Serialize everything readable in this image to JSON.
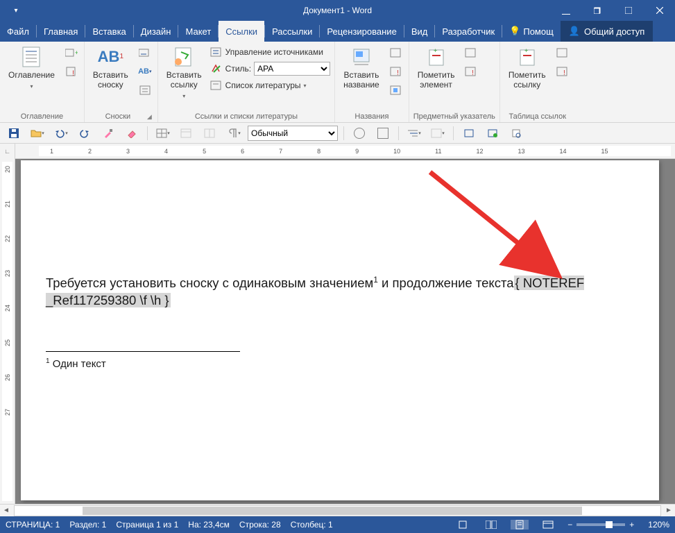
{
  "titlebar": {
    "title": "Документ1 - Word"
  },
  "tabs": {
    "file": "Файл",
    "home": "Главная",
    "insert": "Вставка",
    "design": "Дизайн",
    "layout": "Макет",
    "references": "Ссылки",
    "mailings": "Рассылки",
    "review": "Рецензирование",
    "view": "Вид",
    "developer": "Разработчик",
    "help": "Помощ",
    "share": "Общий доступ"
  },
  "ribbon": {
    "toc": {
      "button": "Оглавление",
      "group": "Оглавление"
    },
    "footnotes": {
      "insert": "Вставить\nсноску",
      "group": "Сноски",
      "ab": "AB"
    },
    "citations": {
      "insert": "Вставить\nссылку",
      "manage": "Управление источниками",
      "style_label": "Стиль:",
      "style_value": "APA",
      "biblio": "Список литературы",
      "group": "Ссылки и списки литературы"
    },
    "captions": {
      "insert": "Вставить\nназвание",
      "group": "Названия"
    },
    "index": {
      "mark": "Пометить\nэлемент",
      "group": "Предметный указатель"
    },
    "toa": {
      "mark": "Пометить\nссылку",
      "group": "Таблица ссылок"
    }
  },
  "qat": {
    "style": "Обычный"
  },
  "document": {
    "line1_a": "Требуется установить сноску с одинаковым значением",
    "line1_b": " и продолжение текста",
    "field": "{ NOTEREF _Ref117259380 \\f \\h }",
    "sup1": "1",
    "footnote_num": "1",
    "footnote_text": " Один текст"
  },
  "status": {
    "page": "СТРАНИЦА: 1",
    "section": "Раздел: 1",
    "pageof": "Страница 1 из 1",
    "at": "На: 23,4см",
    "line": "Строка: 28",
    "col": "Столбец: 1",
    "zoom": "120%"
  }
}
